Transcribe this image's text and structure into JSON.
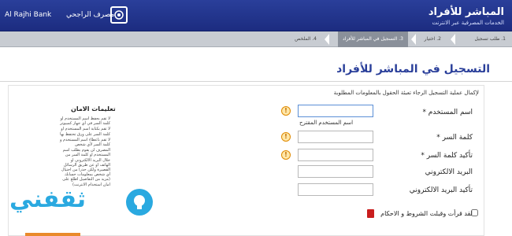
{
  "header": {
    "title": "المباشر للأفراد",
    "subtitle": "الخدمات المصرفية عبر الانترنت",
    "bank_name_ar": "مصرف الراجحي",
    "bank_name_en": "Al Rajhi Bank",
    "colors": {
      "header_bg": "#1f2f86",
      "accent": "#2a3f9a"
    }
  },
  "steps": [
    {
      "label": "1. طلب تسجيل"
    },
    {
      "label": "2. اختيار"
    },
    {
      "label": "3. التسجيل في المباشر للأفراد"
    },
    {
      "label": "4. الملخص"
    }
  ],
  "page": {
    "title": "التسجيل في المباشر للأفراد",
    "intro": "لإكمال عملية التسجيل الرجاء تعبئة الحقول بالمعلومات المطلوبة"
  },
  "form": {
    "username_label": "اسم المستخدم *",
    "suggested_username": "اسم المستخدم المقترح",
    "password_label": "كلمة السر *",
    "confirm_password_label": "تأكيد كلمة السر *",
    "email_label": "البريد الالكتروني",
    "confirm_email_label": "تأكيد البريد الالكتروني",
    "terms_label": "لقد قرأت وقبلت الشروط و الاحكام",
    "info_glyph": "!"
  },
  "security": {
    "title": "تعليمات الامان",
    "tips": [
      "لا تقم بحفظ اسم المستخدم او كلمة السر في أي جهاز كمبيوتر",
      "لا تقم بكتابة اسم المستخدم او كلمة السر على ورق تحتفظ بها",
      "لا تقم باعطاء اسم المستخدم و كلمة السر لأي شخص",
      "المصرف لن يقوم بطلب اسم المستخدم او كلمة السر من خلال البريد الالكتروني او الهاتف او عن طريق الرسائل القصيرة ولكن حذرا من احتيال أي شخص بمعلومات حسابك (مزيد من التفاصيل اطلع على امان استخدام الانترنت)"
    ]
  },
  "watermark": {
    "text": "ثقفني"
  }
}
